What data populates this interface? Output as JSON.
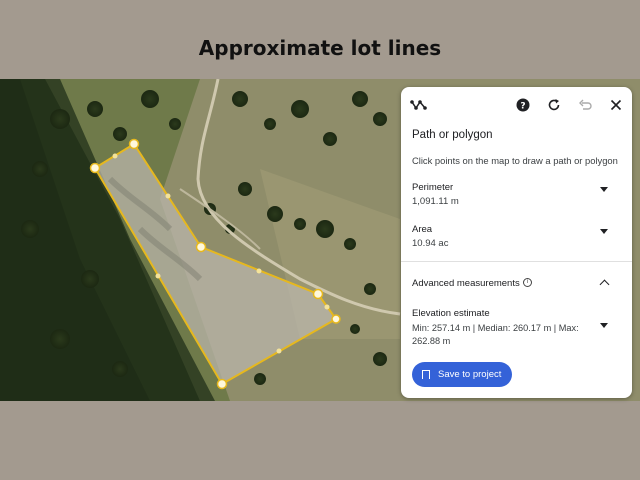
{
  "page": {
    "title": "Approximate lot lines"
  },
  "panel": {
    "toolbar": {
      "mode_icon": "path-draw-icon",
      "help_icon": "help-icon",
      "refresh_icon": "refresh-icon",
      "undo_icon": "undo-icon",
      "close_icon": "close-icon"
    },
    "heading": "Path or polygon",
    "hint": "Click points on the map to draw a path or polygon",
    "perimeter": {
      "label": "Perimeter",
      "value": "1,091.11 m"
    },
    "area": {
      "label": "Area",
      "value": "10.94 ac"
    },
    "advanced": {
      "label": "Advanced measurements",
      "info_glyph": "i"
    },
    "elevation": {
      "label": "Elevation estimate",
      "value": "Min: 257.14 m | Median: 260.17 m | Max: 262.88 m"
    },
    "save_button": "Save to project"
  },
  "colors": {
    "accent": "#3462d8",
    "polygon_stroke": "#e6b81e",
    "background": "#a39a8f"
  }
}
